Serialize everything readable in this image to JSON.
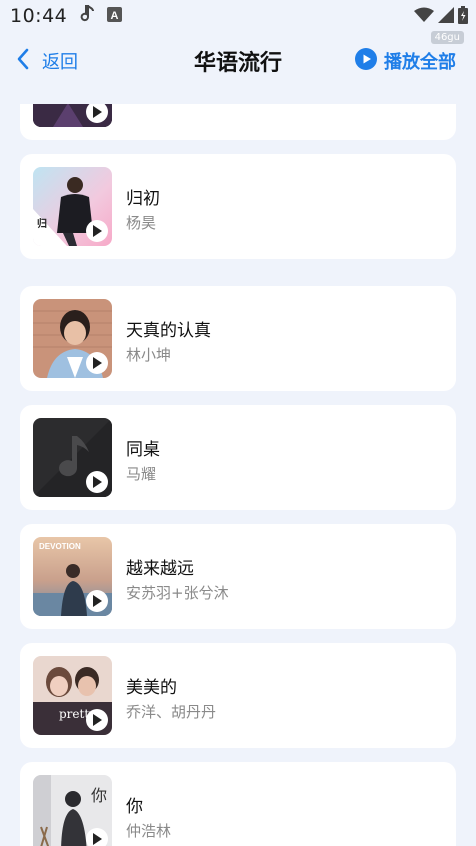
{
  "status_bar": {
    "time": "10:44",
    "left_icons": [
      "music-note-icon",
      "a-keyboard-icon"
    ],
    "right_icons": [
      "wifi-icon",
      "signal-icon",
      "battery-icon"
    ]
  },
  "watermark": "46gu",
  "header": {
    "back_label": "返回",
    "title": "华语流行",
    "play_all_label": "播放全部",
    "accent_color": "#1f7ee8"
  },
  "songs": [
    {
      "title": "",
      "artist": "",
      "cover": "dark-partial"
    },
    {
      "title": "归初",
      "artist": "杨昊",
      "cover": "pink-portrait"
    },
    {
      "title": "天真的认真",
      "artist": "林小坤",
      "cover": "brick-portrait"
    },
    {
      "title": "同桌",
      "artist": "马耀",
      "cover": "default-music-note"
    },
    {
      "title": "越来越远",
      "artist": "安苏羽+张兮沐",
      "cover": "devotion-sunset",
      "cover_text": "DEVOTION"
    },
    {
      "title": "美美的",
      "artist": "乔洋、胡丹丹",
      "cover": "pretty-couple",
      "cover_text": "pretty"
    },
    {
      "title": "你",
      "artist": "仲浩林",
      "cover": "studio-portrait",
      "cover_text": "你"
    }
  ]
}
